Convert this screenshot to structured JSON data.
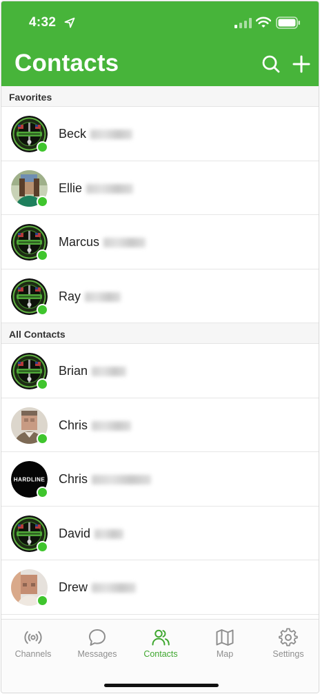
{
  "status_bar": {
    "time": "4:32",
    "icons": [
      "location-arrow-icon",
      "cellular-signal-icon",
      "wifi-icon",
      "battery-icon"
    ]
  },
  "header": {
    "title": "Contacts",
    "actions": [
      "search-icon",
      "plus-icon"
    ],
    "color": "#47b43a"
  },
  "sections": [
    {
      "title": "Favorites",
      "contacts": [
        {
          "first": "Beck",
          "last": "Mitchell",
          "avatar": "badge"
        },
        {
          "first": "Ellie",
          "last": "Johnson",
          "avatar": "photo-woman"
        },
        {
          "first": "Marcus",
          "last": "Benson",
          "avatar": "badge"
        },
        {
          "first": "Ray",
          "last": "Reese",
          "avatar": "badge"
        }
      ]
    },
    {
      "title": "All Contacts",
      "contacts": [
        {
          "first": "Brian",
          "last": "Martin",
          "avatar": "badge"
        },
        {
          "first": "Chris",
          "last": "Dayton",
          "avatar": "photo-man"
        },
        {
          "first": "Chris",
          "last": "Fernandez",
          "avatar": "hardline"
        },
        {
          "first": "David",
          "last": "Ward",
          "avatar": "badge"
        },
        {
          "first": "Drew",
          "last": "Bellamy",
          "avatar": "photo-man2"
        }
      ]
    }
  ],
  "hardline_text": "HARDLINE",
  "tabs": [
    {
      "label": "Channels",
      "icon": "radio-broadcast-icon",
      "active": false
    },
    {
      "label": "Messages",
      "icon": "chat-bubble-icon",
      "active": false
    },
    {
      "label": "Contacts",
      "icon": "people-icon",
      "active": true
    },
    {
      "label": "Map",
      "icon": "map-icon",
      "active": false
    },
    {
      "label": "Settings",
      "icon": "gear-icon",
      "active": false
    }
  ],
  "colors": {
    "accent": "#47b43a",
    "presence": "#3fc52d",
    "active_tab": "#3fa72f",
    "inactive_tab": "#8e8e8e"
  }
}
